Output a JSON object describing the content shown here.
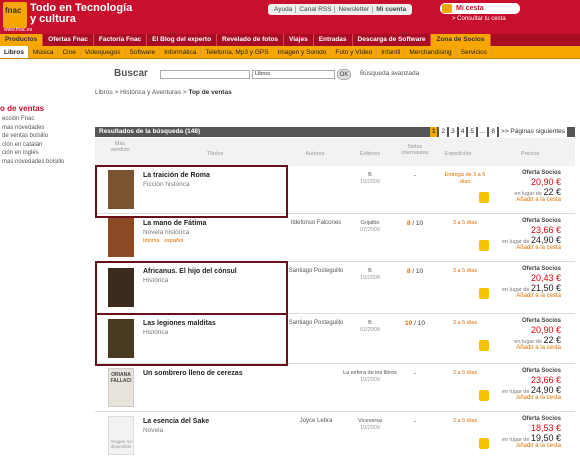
{
  "header": {
    "logo": "fnac",
    "logo_url": "www.fnac.es",
    "tagline": "Todo en Tecnología y cultura",
    "top_links": [
      "Ayuda",
      "Canal RSS",
      "Newsletter",
      "Mi cuenta"
    ],
    "cart": "Mi cesta",
    "consult": "> Consultar tu cesta"
  },
  "nav_main": [
    "Productos",
    "Ofertas Fnac",
    "Factoría Fnac",
    "El Blog del experto",
    "Revelado de fotos",
    "Viajes",
    "Entradas",
    "Descarga de Software",
    "Zona de Socios"
  ],
  "nav_sub": [
    "Libros",
    "Música",
    "Cine",
    "Videojuegos",
    "Software",
    "Informática",
    "Telefonía, Mp3 y GPS",
    "Imagen y Sonido",
    "Foto y Vídeo",
    "Infantil",
    "Merchandising",
    "Servicios"
  ],
  "search": {
    "label": "Buscar",
    "select": "Libros",
    "ok": "OK",
    "advanced": "Búsqueda avanzada"
  },
  "breadcrumb": {
    "path": "Libros > Histórica y Aventuras > ",
    "current": "Top de ventas"
  },
  "sidebar": {
    "title": "o de ventas",
    "items": [
      "ección Fnac",
      "mas novedades",
      "de ventas bolsillo",
      "ción en catalán",
      "ción en inglés",
      "mas novedades bolsillo"
    ]
  },
  "results": {
    "title": "Resultados de la búsqueda (148)",
    "pages": [
      "1",
      "2",
      "3",
      "4",
      "5",
      "...",
      "8"
    ],
    "next": ">> Páginas siguientes"
  },
  "columns": [
    "Más vendido",
    "Títulos",
    "Autores",
    "Editores",
    "Notas internautas",
    "Expedición",
    "Precios"
  ],
  "rows": [
    {
      "title": "La traición de Roma",
      "genre": "Ficción histórica",
      "lang": "",
      "author": "",
      "editor": "B",
      "date": "10/2009",
      "rating": "-",
      "rmax": "",
      "ship": "Entrega de 3 a 5 días",
      "socio": "Oferta Socios",
      "price": "20,90 €",
      "instead": "en lugar de",
      "old": "22 €",
      "add": "Añadir a la cesta"
    },
    {
      "title": "La mano de Fátima",
      "genre": "Novela histórica",
      "lang": "Idioma : español",
      "author": "Ildefonso Falcones",
      "editor": "Grijalbo",
      "date": "07/2009",
      "rating": "8",
      "rmax": "/ 10",
      "ship": "3 a 5 días",
      "socio": "Oferta Socios",
      "price": "23,66 €",
      "instead": "en lugar de",
      "old": "24,90 €",
      "add": "Añadir a la cesta"
    },
    {
      "title": "Africanus. El hijo del cónsul",
      "genre": "Histórica",
      "lang": "",
      "author": "Santiago Posteguillo",
      "editor": "B",
      "date": "10/2008",
      "rating": "8",
      "rmax": "/ 10",
      "ship": "3 a 5 días",
      "socio": "Oferta Socios",
      "price": "20,43 €",
      "instead": "en lugar de",
      "old": "21,50 €",
      "add": "Añadir a la cesta"
    },
    {
      "title": "Las legiones malditas",
      "genre": "Histórica",
      "lang": "",
      "author": "Santiago Posteguillo",
      "editor": "B",
      "date": "02/2008",
      "rating": "10",
      "rmax": "/ 10",
      "ship": "3 a 5 días",
      "socio": "Oferta Socios",
      "price": "20,90 €",
      "instead": "en lugar de",
      "old": "22 €",
      "add": "Añadir a la cesta"
    },
    {
      "title": "Un sombrero lleno de cerezas",
      "genre": "",
      "lang": "",
      "author": "",
      "editor": "La esfera de los libros",
      "date": "10/2009",
      "rating": "-",
      "rmax": "",
      "ship": "3 a 5 días",
      "socio": "Oferta Socios",
      "price": "23,66 €",
      "instead": "en lugar de",
      "old": "24,90 €",
      "add": "Añadir a la cesta"
    },
    {
      "title": "La esencia del Sake",
      "genre": "Novela",
      "lang": "",
      "author": "Joyce Lebra",
      "editor": "Viceversa",
      "date": "10/2009",
      "rating": "-",
      "rmax": "",
      "ship": "3 a 5 días",
      "socio": "Oferta Socios",
      "price": "18,53 €",
      "instead": "en lugar de",
      "old": "19,50 €",
      "add": "Añadir a la cesta"
    }
  ],
  "cover_text": {
    "row5": "ORIANA FALLACI",
    "row6": "Imagen no disponible"
  }
}
